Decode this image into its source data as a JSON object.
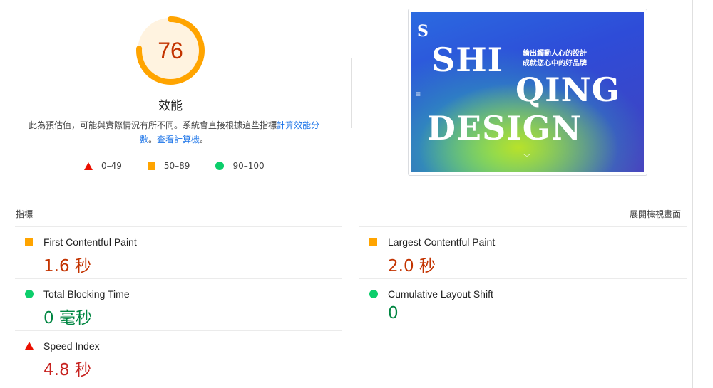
{
  "performance": {
    "score": "76",
    "score_fraction": 0.76,
    "title": "效能",
    "note_text": "此為預估值，可能與實際情況有所不同。系統會直接根據這些指標",
    "note_link": "計算效能分數",
    "note_sep": "。",
    "calculator_link": "查看計算機",
    "note_end": "。",
    "colors": {
      "average": "#ffa400",
      "score_text": "#c33300",
      "ring_bg": "#fff3e0"
    }
  },
  "legend": [
    {
      "range": "0–49",
      "shape": "triangle",
      "color": "#eb0f00"
    },
    {
      "range": "50–89",
      "shape": "square",
      "color": "#ffa400"
    },
    {
      "range": "90–100",
      "shape": "circle",
      "color": "#0cce6b"
    }
  ],
  "thumbnail": {
    "logo": "S",
    "headline_1": "SHI",
    "headline_2": "QING",
    "headline_3": "DESIGN",
    "tagline_1": "繪出觸動人心的設計",
    "tagline_2": "成就您心中的好品牌",
    "menu_icon": "hamburger-icon",
    "scroll_icon": "chevron-down-icon"
  },
  "metrics_header": {
    "label": "指標",
    "expand": "展開檢視畫面"
  },
  "metrics": [
    {
      "name": "First Contentful Paint",
      "value": "1.6 秒",
      "status": "average"
    },
    {
      "name": "Largest Contentful Paint",
      "value": "2.0 秒",
      "status": "average"
    },
    {
      "name": "Total Blocking Time",
      "value": "0 毫秒",
      "status": "good"
    },
    {
      "name": "Cumulative Layout Shift",
      "value": "0",
      "status": "good"
    },
    {
      "name": "Speed Index",
      "value": "4.8 秒",
      "status": "poor"
    }
  ]
}
